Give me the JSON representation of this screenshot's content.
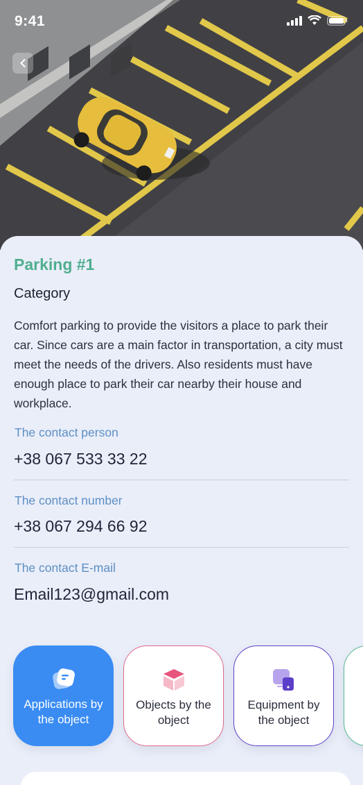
{
  "status_bar": {
    "time": "9:41"
  },
  "place": {
    "title": "Parking #1",
    "category": "Category",
    "description": "Comfort parking to provide the visitors a place to park their car. Since cars are a main factor in transportation, a city must meet the needs of the drivers. Also residents must have enough place to park their car nearby their house and workplace."
  },
  "contacts": [
    {
      "label": "The contact person",
      "value": "+38 067 533 33 22"
    },
    {
      "label": "The contact number",
      "value": "+38 067 294 66 92"
    },
    {
      "label": "The contact E-mail",
      "value": "Email123@gmail.com"
    }
  ],
  "cards": [
    {
      "label": "Applications by the object",
      "icon": "applications-icon",
      "color": "#3a8cf3"
    },
    {
      "label": "Objects by the object",
      "icon": "cube-icon",
      "color": "#e26a8c"
    },
    {
      "label": "Equipment by the object",
      "icon": "equipment-icon",
      "color": "#5b3fc8"
    },
    {
      "label": "",
      "icon": "",
      "color": "#56b78f"
    }
  ],
  "colors": {
    "accent_green": "#4fae8e",
    "label_blue": "#5d8fc4",
    "background": "#eaeef9"
  }
}
